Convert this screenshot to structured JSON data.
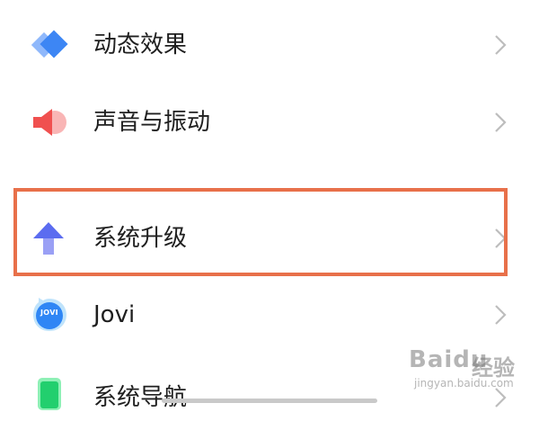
{
  "settings_list": {
    "items": [
      {
        "label": "动态效果",
        "icon": "diamond-layers-icon"
      },
      {
        "label": "声音与振动",
        "icon": "speaker-icon"
      },
      {
        "label": "系统升级",
        "icon": "arrow-up-icon"
      },
      {
        "label": "Jovi",
        "icon": "jovi-bubble-icon",
        "icon_text": "JOVI"
      },
      {
        "label": "系统导航",
        "icon": "green-square-icon"
      }
    ]
  },
  "colors": {
    "highlight": "#e8704a",
    "accent_blue": "#4c8cf5",
    "accent_red": "#f05a5a",
    "accent_green": "#2ecf7a",
    "text": "#1f1f1f",
    "chevron": "#bdbdbd"
  },
  "watermark": {
    "brand": "Baidu",
    "product": "经验",
    "url": "jingyan.baidu.com"
  }
}
